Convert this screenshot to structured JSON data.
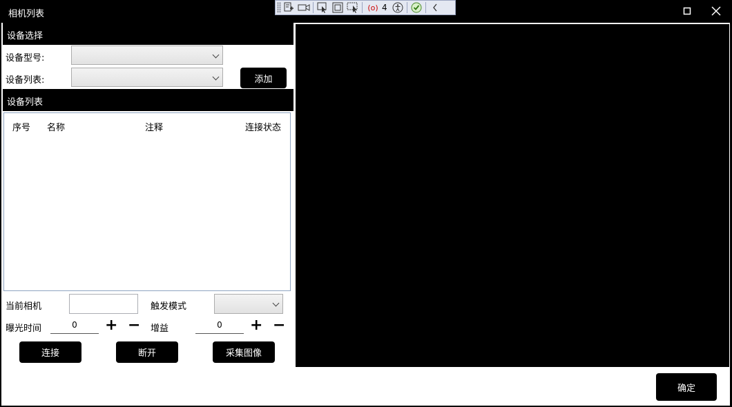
{
  "window": {
    "title": "相机列表"
  },
  "devtools": {
    "badge_count": "4"
  },
  "device_select": {
    "header": "设备选择",
    "model_label": "设备型号:",
    "model_value": "",
    "list_label": "设备列表:",
    "list_value": "",
    "add_button": "添加"
  },
  "device_list": {
    "header": "设备列表",
    "columns": [
      "序号",
      "名称",
      "注释",
      "连接状态"
    ],
    "rows": []
  },
  "controls": {
    "current_camera_label": "当前相机",
    "current_camera_value": "",
    "trigger_mode_label": "触发模式",
    "trigger_mode_value": "",
    "exposure_label": "曝光时间",
    "exposure_value": "0",
    "gain_label": "增益",
    "gain_value": "0",
    "plus_glyph": "+",
    "minus_glyph": "−",
    "connect_button": "连接",
    "disconnect_button": "断开",
    "capture_button": "采集图像"
  },
  "footer": {
    "ok_button": "确定"
  }
}
